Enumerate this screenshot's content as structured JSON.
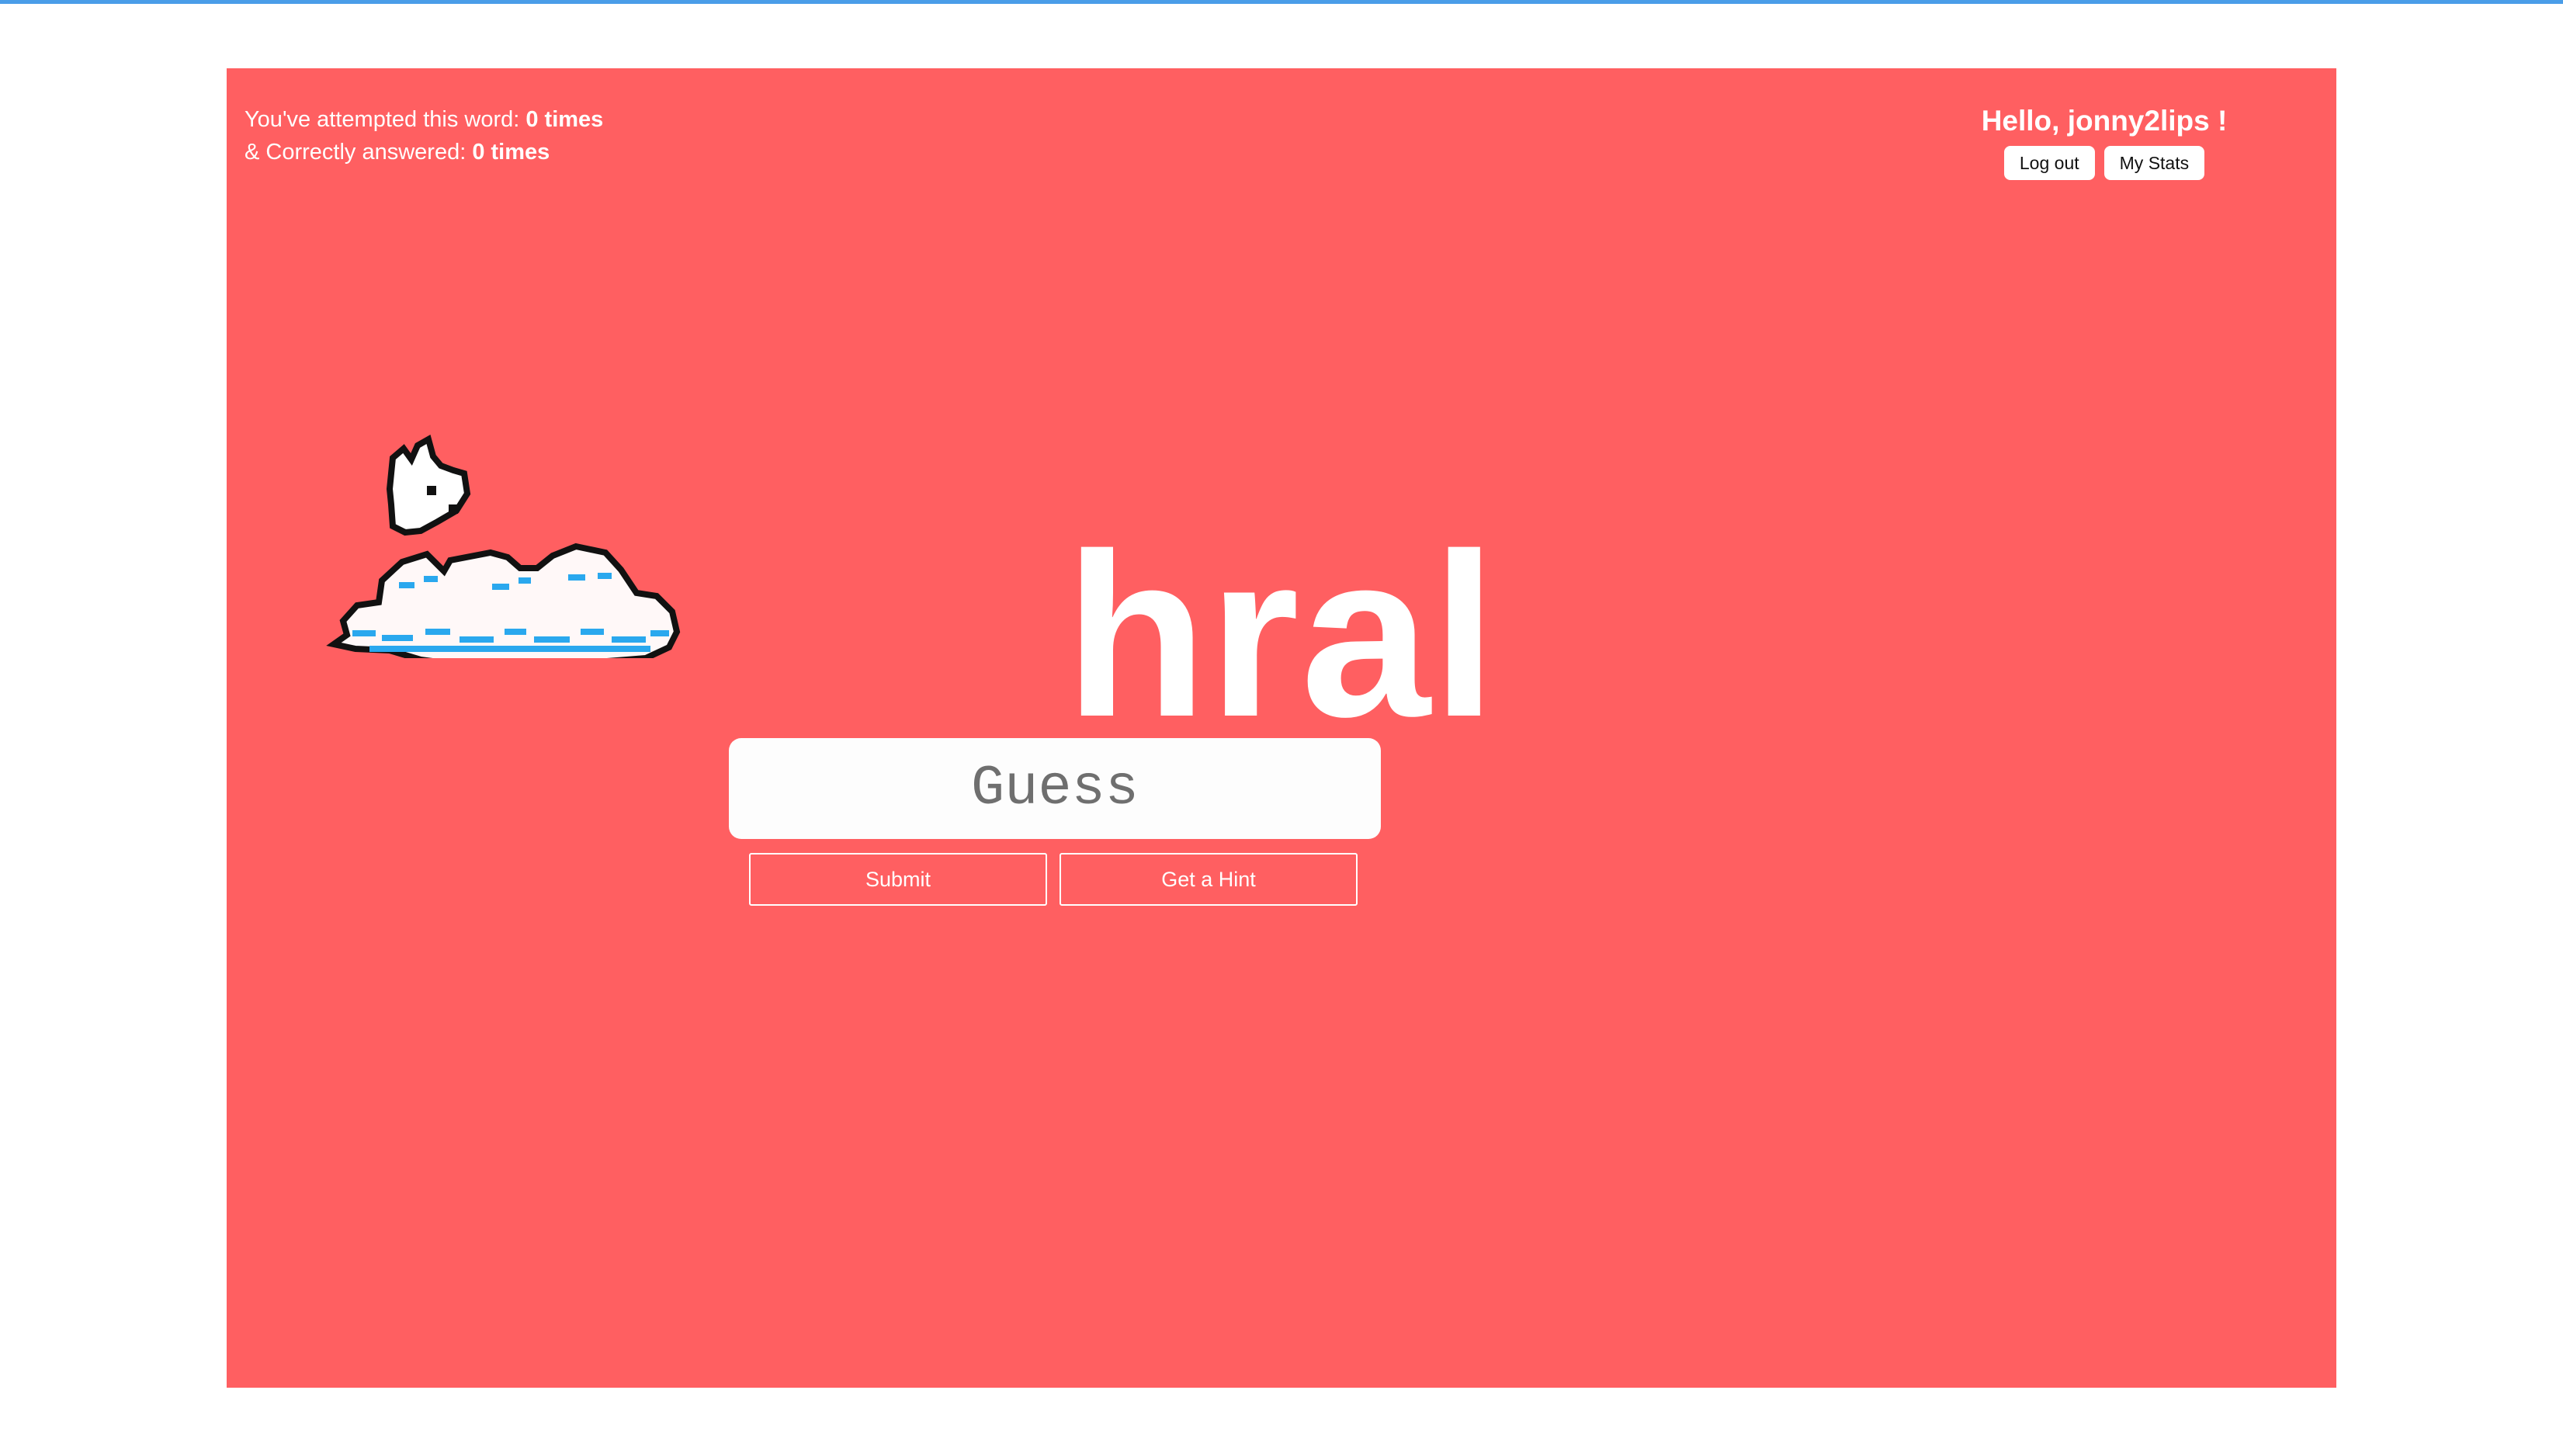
{
  "stats": {
    "attempted_label": "You've attempted this word: ",
    "attempted_value": "0 times",
    "correct_label": "& Correctly answered: ",
    "correct_value": "0 times"
  },
  "user": {
    "greeting": "Hello, jonny2lips !",
    "logout_label": "Log out",
    "stats_label": "My Stats"
  },
  "game": {
    "scrambled_word": "hral",
    "guess_placeholder": "Guess",
    "guess_value": "",
    "submit_label": "Submit",
    "hint_label": "Get a Hint"
  },
  "colors": {
    "background": "#ff5f61",
    "accent_line": "#4a9de8",
    "text": "#ffffff"
  },
  "icons": {
    "mascot": "pixel-bunny-on-cloud"
  }
}
